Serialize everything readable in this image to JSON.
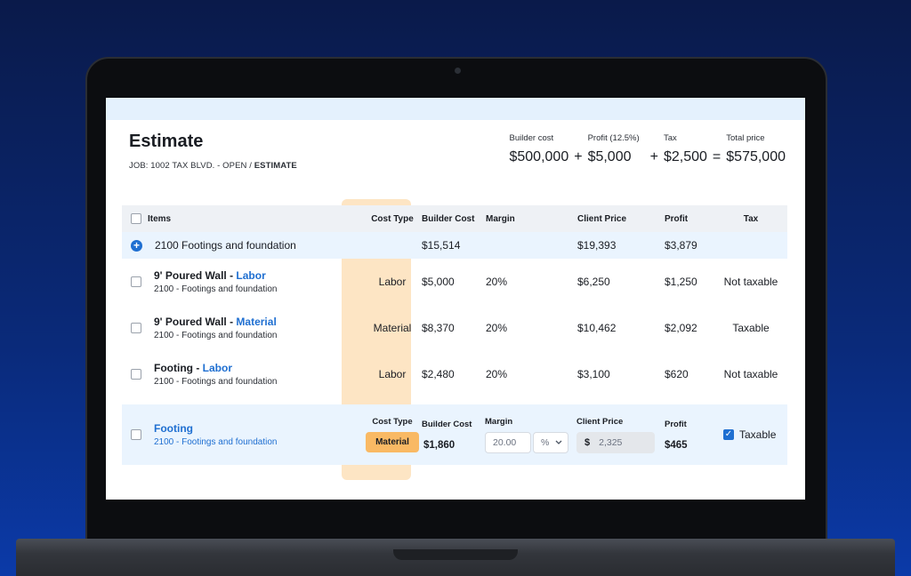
{
  "header": {
    "title": "Estimate",
    "breadcrumb_prefix": "JOB: 1002 TAX BLVD. - OPEN / ",
    "breadcrumb_current": "ESTIMATE"
  },
  "summary": {
    "builder_cost_label": "Builder cost",
    "builder_cost": "$500,000",
    "profit_label": "Profit (12.5%)",
    "profit": "$5,000",
    "tax_label": "Tax",
    "tax": "$2,500",
    "total_label": "Total price",
    "total": "$575,000",
    "op_plus": "+",
    "op_equals": "="
  },
  "columns": {
    "items": "Items",
    "cost_type": "Cost Type",
    "builder_cost": "Builder Cost",
    "margin": "Margin",
    "client_price": "Client Price",
    "profit": "Profit",
    "tax": "Tax"
  },
  "group": {
    "icon": "+",
    "name": "2100 Footings and foundation",
    "builder_cost": "$15,514",
    "client_price": "$19,393",
    "profit": "$3,879"
  },
  "rows": [
    {
      "name_main": "9' Poured Wall - ",
      "name_accent": "Labor",
      "sub": "2100 - Footings and foundation",
      "cost_type": "Labor",
      "builder_cost": "$5,000",
      "margin": "20%",
      "client_price": "$6,250",
      "profit": "$1,250",
      "tax": "Not taxable"
    },
    {
      "name_main": "9' Poured Wall - ",
      "name_accent": "Material",
      "sub": "2100 - Footings and foundation",
      "cost_type": "Material",
      "builder_cost": "$8,370",
      "margin": "20%",
      "client_price": "$10,462",
      "profit": "$2,092",
      "tax": "Taxable"
    },
    {
      "name_main": "Footing - ",
      "name_accent": "Labor",
      "sub": "2100 - Footings and foundation",
      "cost_type": "Labor",
      "builder_cost": "$2,480",
      "margin": "20%",
      "client_price": "$3,100",
      "profit": "$620",
      "tax": "Not taxable"
    }
  ],
  "edit_row": {
    "name": "Footing",
    "sub": "2100 - Footings and foundation",
    "cost_type_label": "Cost Type",
    "cost_type": "Material",
    "builder_cost_label": "Builder Cost",
    "builder_cost": "$1,860",
    "margin_label": "Margin",
    "margin_value": "20.00",
    "margin_unit": "%",
    "margin_unit_icon": "chevron-down-icon",
    "client_price_label": "Client Price",
    "client_price_currency": "$",
    "client_price_value": "2,325",
    "profit_label": "Profit",
    "profit": "$465",
    "tax_checked": "✓",
    "tax": "Taxable"
  },
  "colors": {
    "accent": "#1f6fd1",
    "cost_type_band": "#fde5c4",
    "material_badge": "#f9b964",
    "row_highlight": "#eaf4fe"
  }
}
